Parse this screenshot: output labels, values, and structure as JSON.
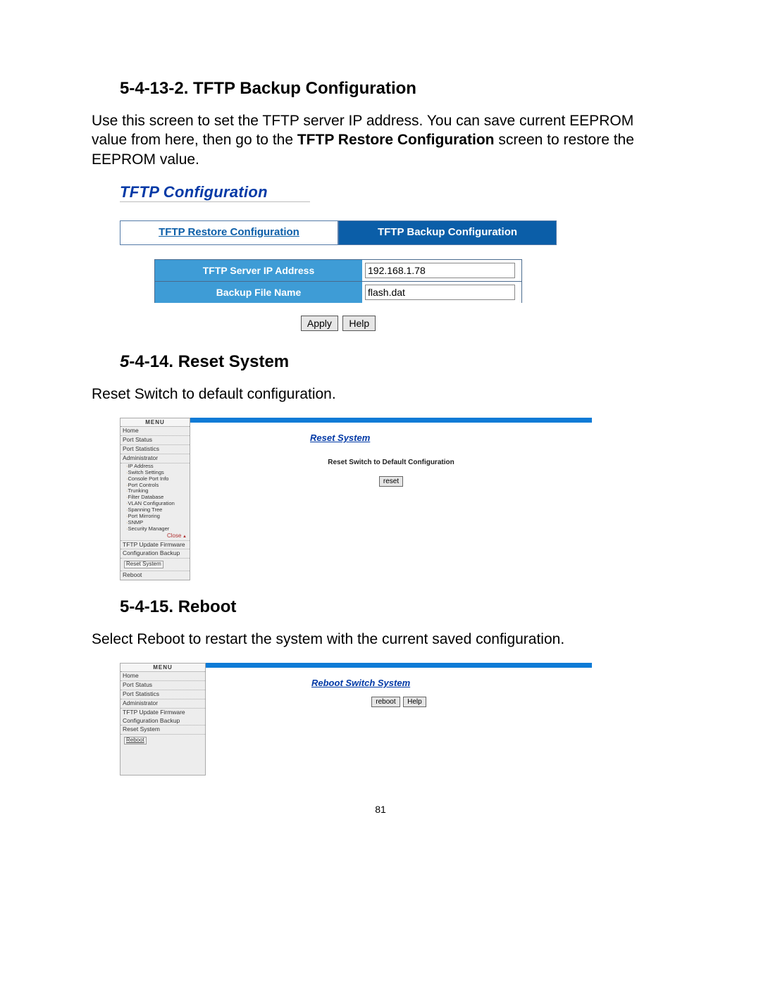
{
  "section1": {
    "heading": "5-4-13-2. TFTP Backup Configuration",
    "para_pre": "Use this screen to set the TFTP server IP address. You can save current EEPROM value from here, then go to the ",
    "para_strong": "TFTP Restore Configuration",
    "para_post": " screen to restore the EEPROM value.",
    "panel": {
      "title": "TFTP Configuration",
      "tab_link": "TFTP Restore Configuration",
      "tab_active": "TFTP Backup Configuration",
      "row1_label": "TFTP Server IP Address",
      "row1_value": "192.168.1.78",
      "row2_label": "Backup File Name",
      "row2_value": "flash.dat",
      "btn_apply": "Apply",
      "btn_help": "Help"
    }
  },
  "section2": {
    "heading_prefix": "5",
    "heading_rest": "-4-14. Reset System",
    "para": "Reset Switch to default configuration.",
    "panel": {
      "menu_header": "MENU",
      "items_top": [
        "Home",
        "Port Status",
        "Port Statistics",
        "Administrator"
      ],
      "sub_items": [
        "IP Address",
        "Switch Settings",
        "Console Port Info",
        "Port Controls",
        "Trunking",
        "Filter Database",
        "VLAN Configuration",
        "Spanning Tree",
        "Port Mirroring",
        "SNMP",
        "Security Manager"
      ],
      "close_label": "Close",
      "items_bottom": [
        "TFTP Update Firmware",
        "Configuration Backup"
      ],
      "boxed_item": "Reset System",
      "last_item": "Reboot",
      "content_title": "Reset System",
      "content_instr": "Reset Switch to Default Configuration",
      "btn_reset": "reset"
    }
  },
  "section3": {
    "heading": "5-4-15. Reboot",
    "para": "Select Reboot to restart the system with the current saved configuration.",
    "panel": {
      "menu_header": "MENU",
      "items": [
        "Home",
        "Port Status",
        "Port Statistics",
        "Administrator",
        "TFTP Update Firmware",
        "Configuration Backup",
        "Reset System"
      ],
      "boxed_item": "Reboot",
      "content_title": "Reboot Switch System",
      "btn_reboot": "reboot",
      "btn_help": "Help"
    }
  },
  "page_number": "81"
}
